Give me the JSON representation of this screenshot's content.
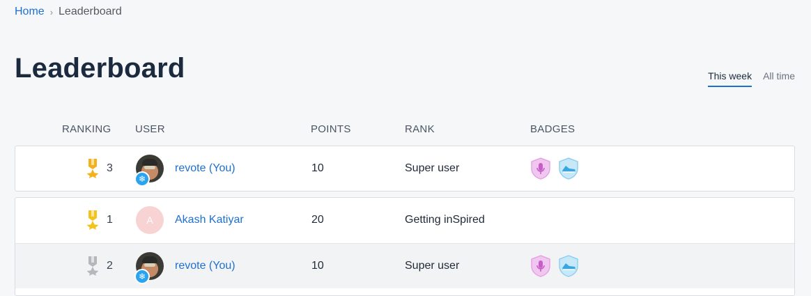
{
  "breadcrumb": {
    "home": "Home",
    "separator": "›",
    "current": "Leaderboard"
  },
  "page": {
    "title": "Leaderboard"
  },
  "tabs": [
    {
      "label": "This week",
      "active": true
    },
    {
      "label": "All time",
      "active": false
    }
  ],
  "columns": {
    "ranking": "RANKING",
    "user": "USER",
    "points": "POINTS",
    "rank": "RANK",
    "badges": "BADGES"
  },
  "colors": {
    "link": "#1f6fd1",
    "gold": "#f3b21b",
    "silver": "#b4b7bb",
    "badge_pink": "#e6a2e6",
    "badge_blue": "#8fd0f0"
  },
  "you_row": {
    "ranking": "3",
    "medal": "gold-medal-icon",
    "name": "revote (You)",
    "points": "10",
    "rank": "Super user",
    "badges": [
      "microphone-badge-icon",
      "sneaker-badge-icon"
    ]
  },
  "rows": [
    {
      "ranking": "1",
      "medal": "gold-medal-icon",
      "avatar_letter": "A",
      "name": "Akash Katiyar",
      "points": "20",
      "rank": "Getting inSpired",
      "badges": []
    },
    {
      "ranking": "2",
      "medal": "silver-medal-icon",
      "name": "revote (You)",
      "points": "10",
      "rank": "Super user",
      "badges": [
        "microphone-badge-icon",
        "sneaker-badge-icon"
      ]
    }
  ]
}
